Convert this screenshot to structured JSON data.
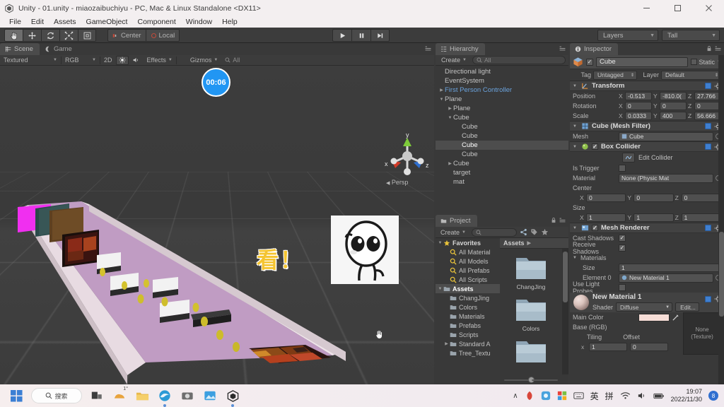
{
  "window": {
    "title": "Unity - 01.unity - miaozaibuchiyu - PC, Mac & Linux Standalone <DX11>",
    "app_icon": "unity-logo-icon",
    "minimize": "minimize-icon",
    "maximize": "maximize-icon",
    "close": "close-icon"
  },
  "menu": {
    "items": [
      "File",
      "Edit",
      "Assets",
      "GameObject",
      "Component",
      "Window",
      "Help"
    ]
  },
  "toolbar": {
    "tools": [
      {
        "name": "hand-tool",
        "glyph": "hand"
      },
      {
        "name": "move-tool",
        "glyph": "move"
      },
      {
        "name": "rotate-tool",
        "glyph": "rotate"
      },
      {
        "name": "scale-tool",
        "glyph": "scale"
      },
      {
        "name": "rect-tool",
        "glyph": "rect"
      }
    ],
    "pivot_mode": "Center",
    "pivot_rotation": "Local",
    "play": "play-icon",
    "pause": "pause-icon",
    "step": "step-icon",
    "layers_label": "Layers",
    "layout_label": "Tall"
  },
  "scene": {
    "tabs": [
      {
        "label": "Scene",
        "icon": "scene-grid-icon",
        "active": true
      },
      {
        "label": "Game",
        "icon": "game-moon-icon",
        "active": false
      }
    ],
    "subbar": {
      "draw_mode": "Textured",
      "color_mode": "RGB",
      "two_d": "2D",
      "lighting": "light-bulb-icon",
      "audio": "audio-icon",
      "effects": "Effects",
      "gizmos": "Gizmos",
      "search_placeholder": "All"
    },
    "gizmo": {
      "x_label": "x",
      "y_label": "y",
      "z_label": "z",
      "projection": "Persp",
      "x_color": "#d03a28",
      "y_color": "#7ecb3a",
      "z_color": "#2f6fd0"
    },
    "overlay": {
      "meme_text": "看！",
      "meme_image": "doge-meme-face",
      "timer": "00:06",
      "timer_color": "#2196f3"
    },
    "cursor": "hand-cursor"
  },
  "hierarchy": {
    "tab_label": "Hierarchy",
    "tab_icon": "hierarchy-icon",
    "create_label": "Create",
    "search_placeholder": "All",
    "items": [
      {
        "label": "Directional light",
        "depth": 0,
        "arrow": "",
        "selected": false,
        "prefab": false
      },
      {
        "label": "EventSystem",
        "depth": 0,
        "arrow": "",
        "selected": false,
        "prefab": false
      },
      {
        "label": "First Person Controller",
        "depth": 0,
        "arrow": "collapsed",
        "selected": false,
        "prefab": true
      },
      {
        "label": "Plane",
        "depth": 0,
        "arrow": "expanded",
        "selected": false,
        "prefab": false
      },
      {
        "label": "Plane",
        "depth": 1,
        "arrow": "collapsed",
        "selected": false,
        "prefab": false
      },
      {
        "label": "Cube",
        "depth": 1,
        "arrow": "expanded",
        "selected": false,
        "prefab": false
      },
      {
        "label": "Cube",
        "depth": 2,
        "arrow": "",
        "selected": false,
        "prefab": false
      },
      {
        "label": "Cube",
        "depth": 2,
        "arrow": "",
        "selected": false,
        "prefab": false
      },
      {
        "label": "Cube",
        "depth": 2,
        "arrow": "",
        "selected": true,
        "prefab": false
      },
      {
        "label": "Cube",
        "depth": 2,
        "arrow": "",
        "selected": false,
        "prefab": false
      },
      {
        "label": "Cube",
        "depth": 1,
        "arrow": "collapsed",
        "selected": false,
        "prefab": false
      },
      {
        "label": "target",
        "depth": 1,
        "arrow": "",
        "selected": false,
        "prefab": false
      },
      {
        "label": "mat",
        "depth": 1,
        "arrow": "",
        "selected": false,
        "prefab": false
      }
    ]
  },
  "project": {
    "tab_label": "Project",
    "tab_icon": "project-folder-icon",
    "create_label": "Create",
    "search_placeholder": "",
    "icons": [
      "share-icon",
      "label-icon",
      "favorite-star-icon"
    ],
    "breadcrumb": "Assets",
    "tree": [
      {
        "label": "Favorites",
        "type": "header",
        "icon": "star-icon",
        "arrow": "expanded",
        "depth": 0
      },
      {
        "label": "All Material",
        "type": "search",
        "icon": "search-icon",
        "arrow": "",
        "depth": 1
      },
      {
        "label": "All Models",
        "type": "search",
        "icon": "search-icon",
        "arrow": "",
        "depth": 1
      },
      {
        "label": "All Prefabs",
        "type": "search",
        "icon": "search-icon",
        "arrow": "",
        "depth": 1
      },
      {
        "label": "All Scripts",
        "type": "search",
        "icon": "search-icon",
        "arrow": "",
        "depth": 1
      },
      {
        "label": "Assets",
        "type": "folder-selected",
        "icon": "folder-icon",
        "arrow": "expanded",
        "depth": 0
      },
      {
        "label": "ChangJing",
        "type": "folder",
        "icon": "folder-icon",
        "arrow": "",
        "depth": 1
      },
      {
        "label": "Colors",
        "type": "folder",
        "icon": "folder-icon",
        "arrow": "",
        "depth": 1
      },
      {
        "label": "Materials",
        "type": "folder",
        "icon": "folder-icon",
        "arrow": "",
        "depth": 1
      },
      {
        "label": "Prefabs",
        "type": "folder",
        "icon": "folder-icon",
        "arrow": "",
        "depth": 1
      },
      {
        "label": "Scripts",
        "type": "folder",
        "icon": "folder-icon",
        "arrow": "",
        "depth": 1
      },
      {
        "label": "Standard A",
        "type": "folder",
        "icon": "folder-icon",
        "arrow": "collapsed",
        "depth": 1
      },
      {
        "label": "Tree_Textu",
        "type": "folder",
        "icon": "folder-icon",
        "arrow": "",
        "depth": 1
      }
    ],
    "assets": [
      {
        "label": "ChangJing",
        "icon": "folder-large-icon"
      },
      {
        "label": "Colors",
        "icon": "folder-large-icon"
      },
      {
        "label": "",
        "icon": "folder-large-icon"
      }
    ]
  },
  "inspector": {
    "tab_label": "Inspector",
    "tab_icon": "inspector-info-icon",
    "lock_icon": "lock-icon",
    "object": {
      "icon": "cube-icon",
      "enabled": true,
      "name": "Cube",
      "static_label": "Static",
      "static_checked": false,
      "tag_label": "Tag",
      "tag_value": "Untagged",
      "layer_label": "Layer",
      "layer_value": "Default"
    },
    "components": [
      {
        "name": "Transform",
        "icon": "transform-icon",
        "expanded": true,
        "has_checkbox": false,
        "rows": [
          {
            "label": "Position",
            "x": "-0.513",
            "y": "-810.0(",
            "z": "27.766"
          },
          {
            "label": "Rotation",
            "x": "0",
            "y": "0",
            "z": "0"
          },
          {
            "label": "Scale",
            "x": "0.0333",
            "y": "400",
            "z": "56.666"
          }
        ]
      },
      {
        "name": "Cube (Mesh Filter)",
        "icon": "mesh-filter-icon",
        "expanded": true,
        "has_checkbox": false,
        "mesh_label": "Mesh",
        "mesh_value": "Cube"
      },
      {
        "name": "Box Collider",
        "icon": "box-collider-icon",
        "expanded": true,
        "has_checkbox": true,
        "checked": true,
        "edit_collider_label": "Edit Collider",
        "is_trigger_label": "Is Trigger",
        "is_trigger_checked": false,
        "material_label": "Material",
        "material_value": "None (Physic Mat",
        "center_label": "Center",
        "center": {
          "x": "0",
          "y": "0",
          "z": "0"
        },
        "size_label": "Size",
        "size": {
          "x": "1",
          "y": "1",
          "z": "1"
        }
      },
      {
        "name": "Mesh Renderer",
        "icon": "mesh-renderer-icon",
        "expanded": true,
        "has_checkbox": true,
        "checked": true,
        "cast_shadows_label": "Cast Shadows",
        "cast_shadows_checked": true,
        "receive_shadows_label": "Receive Shadows",
        "receive_shadows_checked": true,
        "materials_label": "Materials",
        "size_label": "Size",
        "size_value": "1",
        "element_label": "Element 0",
        "element_value": "New Material 1",
        "light_probes_label": "Use Light Probes",
        "light_probes_checked": false
      }
    ],
    "material": {
      "name": "New Material 1",
      "shader_label": "Shader",
      "shader_value": "Diffuse",
      "edit_label": "Edit...",
      "main_color_label": "Main Color",
      "main_color_value": "#f6ddd6",
      "base_rgb_label": "Base (RGB)",
      "texture_none_label": "None\n(Texture)",
      "tiling_label": "Tiling",
      "offset_label": "Offset",
      "tiling_axis": "x",
      "tiling_value": "1",
      "offset_value": "0"
    }
  },
  "taskbar": {
    "start": "windows-start-icon",
    "search_label": "搜索",
    "search_icon": "search-icon",
    "apps": [
      {
        "name": "task-view-icon"
      },
      {
        "name": "weather-icon",
        "badge": "1°"
      },
      {
        "name": "file-explorer-icon"
      },
      {
        "name": "edge-browser-icon"
      },
      {
        "name": "camera-icon"
      },
      {
        "name": "photos-icon"
      },
      {
        "name": "unity-app-icon"
      }
    ],
    "tray": [
      {
        "name": "show-hidden-icons-chevron"
      },
      {
        "name": "antivirus-icon"
      },
      {
        "name": "browser-tray-icon"
      },
      {
        "name": "windows-tray-icon"
      },
      {
        "name": "keyboard-icon"
      }
    ],
    "ime_lang": "英",
    "ime_mode": "拼",
    "network": "wifi-icon",
    "volume": "speaker-icon",
    "battery": "battery-icon",
    "time": "19:07",
    "date": "2022/11/30",
    "notification_count": "8"
  }
}
